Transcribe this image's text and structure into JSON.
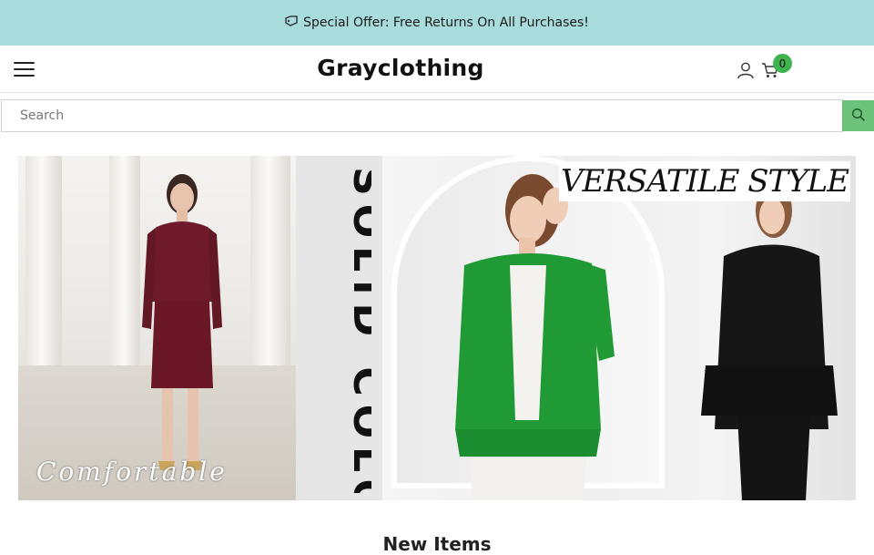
{
  "announcement": {
    "icon": "tag-icon",
    "text": "Special Offer: Free Returns On All Purchases!"
  },
  "header": {
    "brand": "Grayclothing",
    "cart_count": "0",
    "icons": [
      "menu-icon",
      "user-icon",
      "cart-icon"
    ]
  },
  "search": {
    "placeholder": "Search",
    "value": "",
    "icon": "search-icon"
  },
  "banner": {
    "headline": "VERSATILE STYLE",
    "vertical_text": "SOLID COLOR",
    "script_text": "Comfortable"
  },
  "sections": {
    "new_items_title": "New Items"
  },
  "colors": {
    "announcement_bg": "#a9dcdc",
    "accent_green": "#6cc17b",
    "badge_green": "#3fb34f"
  }
}
